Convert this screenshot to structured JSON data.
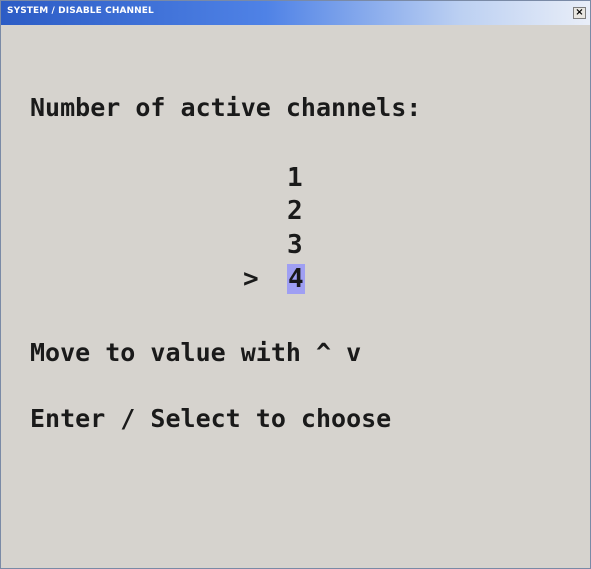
{
  "window": {
    "title": "SYSTEM / DISABLE CHANNEL",
    "close_label": "×"
  },
  "screen": {
    "heading": "Number of active channels:",
    "options": [
      "1",
      "2",
      "3",
      "4"
    ],
    "selected_option": "4",
    "pointer": ">",
    "hint_move": "Move to value with ^ v",
    "hint_select": "Enter / Select to choose"
  },
  "colors": {
    "titlebar_start": "#2c5cc5",
    "titlebar_end": "#e9eef8",
    "background": "#d6d3ce",
    "selection_highlight": "#9f9ff3",
    "text": "#1a1a1a"
  }
}
